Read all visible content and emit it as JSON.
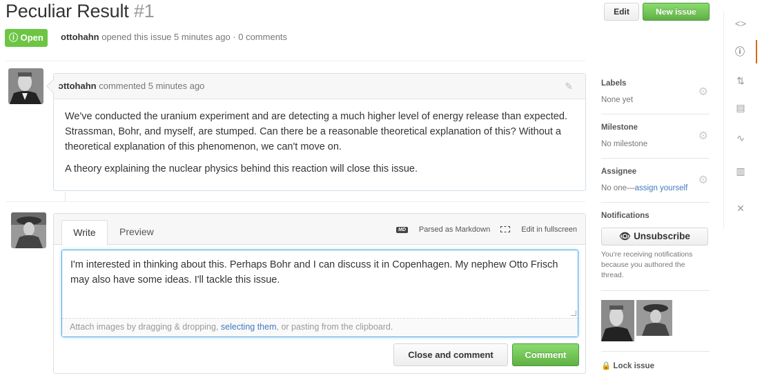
{
  "issue": {
    "title": "Peculiar Result",
    "number": "#1",
    "state": "Open",
    "author": "ottohahn",
    "meta_text": "opened this issue 5 minutes ago · 0 comments"
  },
  "header": {
    "edit_label": "Edit",
    "new_issue_label": "New issue"
  },
  "comment": {
    "author": "ottohahn",
    "time_text": "commented 5 minutes ago",
    "paragraph_1": "We've conducted the uranium experiment and are detecting a much higher level of energy release than expected. Strassman, Bohr, and myself, are stumped. Can there be a reasonable theoretical explanation of this? Without a theoretical explanation of this phenomenon, we can't move on.",
    "paragraph_2": "A theory explaining the nuclear physics behind this reaction will close this issue."
  },
  "new_comment": {
    "tab_write": "Write",
    "tab_preview": "Preview",
    "markdown_badge": "MD",
    "markdown_note": "Parsed as Markdown",
    "fullscreen_label": "Edit in fullscreen",
    "text": "I'm interested in thinking about this. Perhaps Bohr and I can discuss it in Copenhagen. My nephew Otto Frisch may also have some ideas. I'll tackle this issue.",
    "attach_prefix": "Attach images by dragging & dropping, ",
    "attach_link": "selecting them",
    "attach_suffix": ", or pasting from the clipboard.",
    "close_label": "Close and comment",
    "comment_label": "Comment"
  },
  "sidebar": {
    "labels_heading": "Labels",
    "labels_value": "None yet",
    "milestone_heading": "Milestone",
    "milestone_value": "No milestone",
    "assignee_heading": "Assignee",
    "assignee_value": "No one—",
    "assignee_link": "assign yourself",
    "notifications_heading": "Notifications",
    "unsubscribe_label": "Unsubscribe",
    "notifications_note": "You're receiving notifications because you authored the thread.",
    "lock_label": "Lock issue"
  },
  "rail": {
    "items": [
      "code-icon",
      "issues-icon",
      "pull-requests-icon",
      "wiki-icon",
      "pulse-icon",
      "graphs-icon",
      "settings-icon"
    ]
  },
  "colors": {
    "green": "#6cc644",
    "link": "#4078c0",
    "rail_active": "#d26911",
    "focus_border": "#51a7e8"
  }
}
